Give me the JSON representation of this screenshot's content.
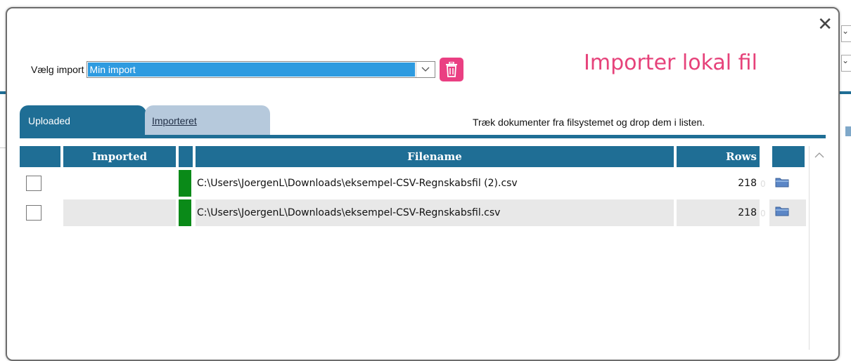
{
  "dialog": {
    "title": "Importer lokal fil",
    "close_label": "✕"
  },
  "import": {
    "label": "Vælg import",
    "selected": "Min import"
  },
  "tabs": [
    {
      "label": "Uploaded",
      "active": true
    },
    {
      "label": "Importeret",
      "active": false
    }
  ],
  "drop_hint": "Træk dokumenter fra filsystemet og drop dem i listen.",
  "table": {
    "columns": [
      "Imported",
      "Filename",
      "Rows"
    ],
    "rows": [
      {
        "checked": false,
        "imported": "",
        "filename": "C:\\Users\\JoergenL\\Downloads\\eksempel-CSV-Regnskabsfil (2).csv",
        "rows": "218",
        "ghost": "0"
      },
      {
        "checked": false,
        "imported": "",
        "filename": "C:\\Users\\JoergenL\\Downloads\\eksempel-CSV-Regnskabsfil.csv",
        "rows": "218",
        "ghost": "0"
      }
    ]
  },
  "colors": {
    "accent": "#1f6e95",
    "title": "#e6427a",
    "trash": "#ea3f82",
    "status_ok": "#0a8a18",
    "select_highlight": "#2e9be0"
  },
  "icons": {
    "close": "close-icon",
    "trash": "trash-icon",
    "dropdown": "chevron-down-icon",
    "file": "folder-icon",
    "scroll": "chevron-up-icon"
  }
}
